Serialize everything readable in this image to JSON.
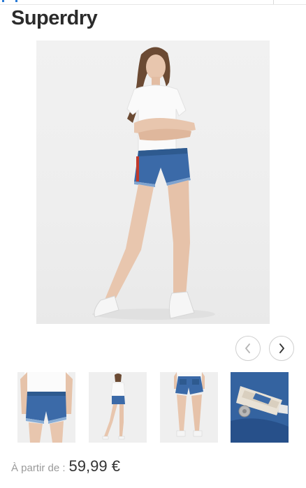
{
  "brand": {
    "name": "Superdry"
  },
  "product": {
    "main_image_alt": "",
    "thumbnails": [
      {
        "subject": "shorts-front-closeup"
      },
      {
        "subject": "full-body-model"
      },
      {
        "subject": "shorts-back-view"
      },
      {
        "subject": "denim-label-detail"
      }
    ]
  },
  "price": {
    "label": "À partir de :",
    "value": "59,99 €"
  },
  "carousel": {
    "prev_icon": "chevron-left-icon",
    "next_icon": "chevron-right-icon"
  },
  "colors": {
    "accent": "#2a7bd6",
    "text": "#333333",
    "muted": "#9a9a9a",
    "denim": "#3b6aa8"
  }
}
